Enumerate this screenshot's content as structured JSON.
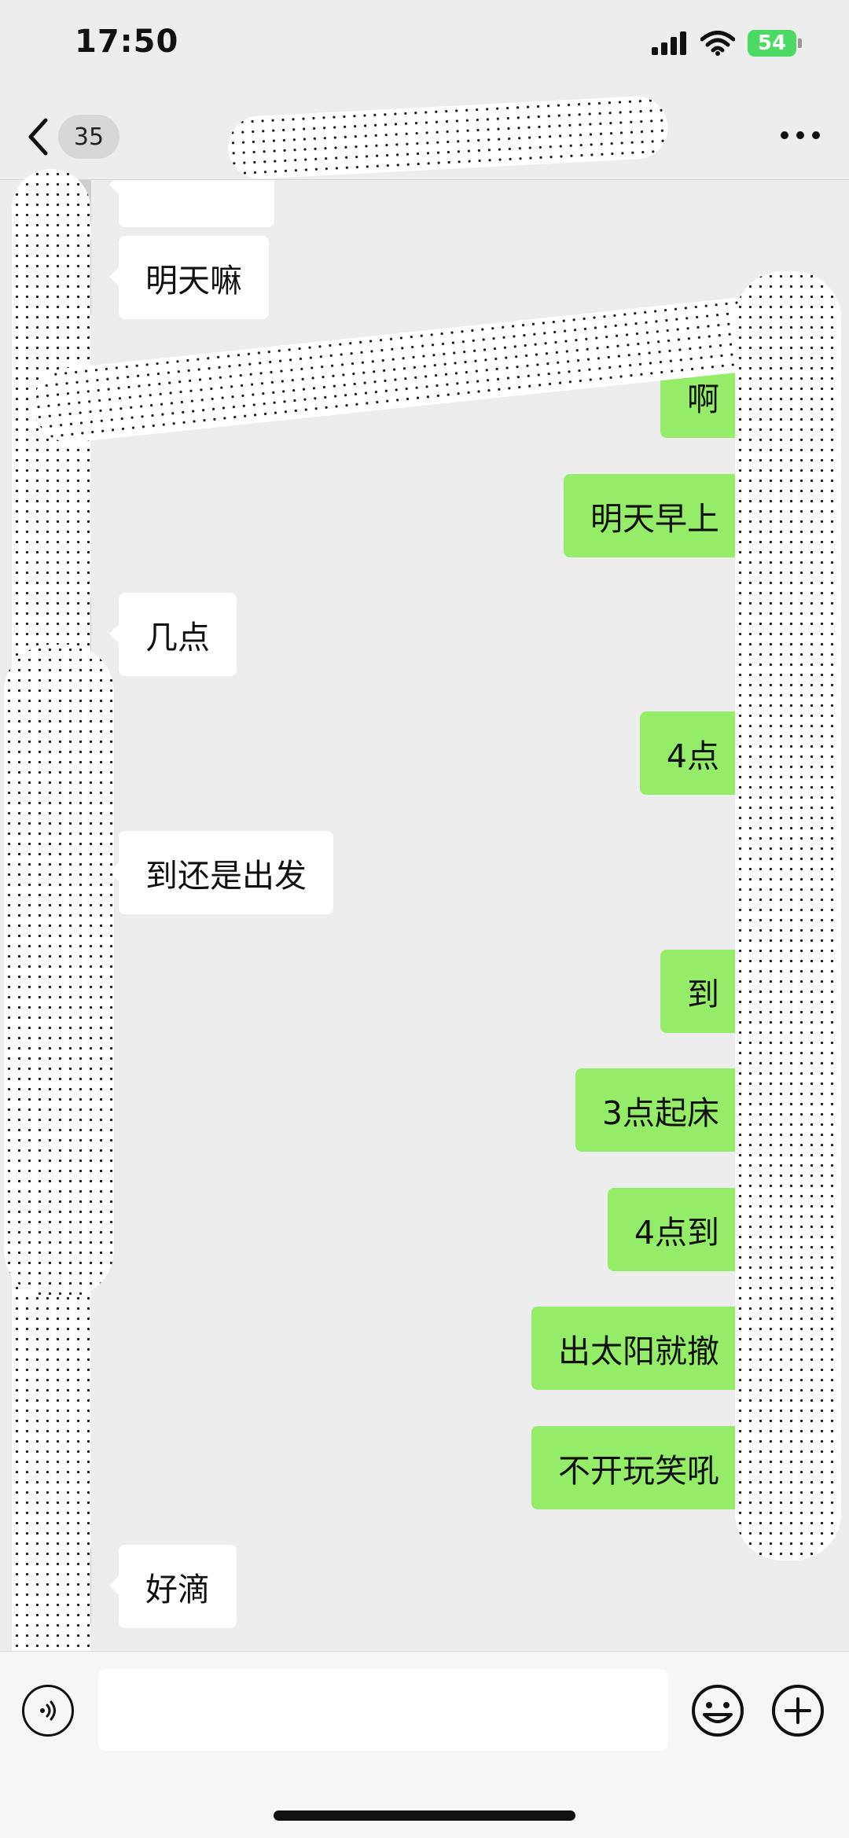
{
  "status_bar": {
    "time": "17:50",
    "battery": "54"
  },
  "header": {
    "back_label": "",
    "unread_count": "35",
    "title": "",
    "more_icon": "more-icon"
  },
  "messages": [
    {
      "side": "in",
      "text": "明天嘛"
    },
    {
      "side": "out",
      "text": "啊"
    },
    {
      "side": "out",
      "text": "明天早上"
    },
    {
      "side": "in",
      "text": "几点"
    },
    {
      "side": "out",
      "text": "4点"
    },
    {
      "side": "in",
      "text": "到还是出发"
    },
    {
      "side": "out",
      "text": "到"
    },
    {
      "side": "out",
      "text": "3点起床"
    },
    {
      "side": "out",
      "text": "4点到"
    },
    {
      "side": "out",
      "text": "出太阳就撤"
    },
    {
      "side": "out",
      "text": "不开玩笑吼"
    },
    {
      "side": "in",
      "text": "好滴"
    }
  ],
  "input_bar": {
    "text_value": "",
    "placeholder": ""
  },
  "colors": {
    "outgoing": "#95ec69",
    "incoming": "#ffffff",
    "background": "#ededed"
  }
}
